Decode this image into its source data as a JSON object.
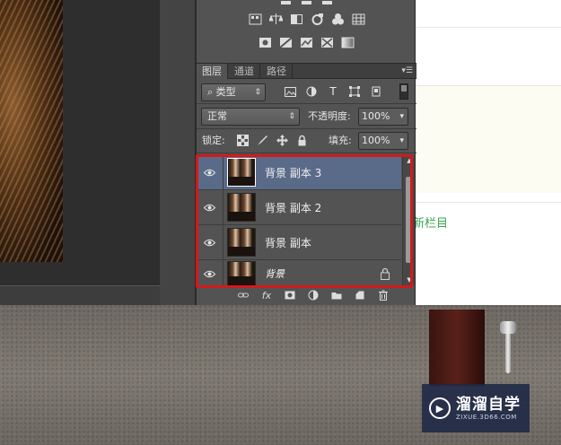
{
  "panel": {
    "tabs": [
      {
        "label": "图层",
        "active": true
      },
      {
        "label": "通道",
        "active": false
      },
      {
        "label": "路径",
        "active": false
      }
    ],
    "filter": {
      "label": "类型",
      "icon": "search-icon"
    },
    "blend_mode": "正常",
    "opacity": {
      "label": "不透明度:",
      "value": "100%"
    },
    "lock_label": "锁定:",
    "fill": {
      "label": "填充:",
      "value": "100%"
    },
    "layers": [
      {
        "name": "背景 副本 3",
        "selected": true,
        "visible": true,
        "locked": false
      },
      {
        "name": "背景 副本 2",
        "selected": false,
        "visible": true,
        "locked": false
      },
      {
        "name": "背景 副本",
        "selected": false,
        "visible": true,
        "locked": false
      },
      {
        "name": "背景",
        "selected": false,
        "visible": true,
        "locked": true
      }
    ]
  },
  "web": {
    "link_text": "新栏目"
  },
  "watermark": {
    "name": "溜溜自学",
    "url": "ZIXUE.3D66.COM"
  },
  "colors": {
    "highlight": "#d21a1a",
    "selected_layer": "#5a6b89",
    "panel_bg": "#535353",
    "link": "#3aa64c"
  }
}
